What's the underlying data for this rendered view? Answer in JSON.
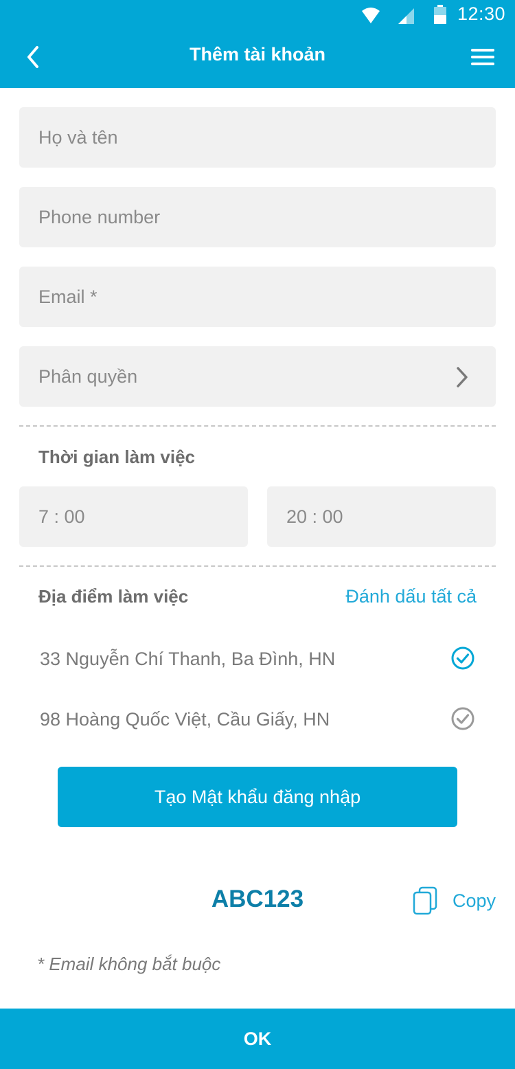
{
  "status_bar": {
    "time": "12:30"
  },
  "header": {
    "title": "Thêm tài khoản"
  },
  "form": {
    "full_name_placeholder": "Họ và tên",
    "phone_placeholder": "Phone number",
    "email_placeholder": "Email *",
    "role_placeholder": "Phân quyền"
  },
  "working_time": {
    "label": "Thời gian làm việc",
    "start": "7 : 00",
    "end": "20 : 00"
  },
  "working_location": {
    "label": "Địa điểm làm việc",
    "mark_all": "Đánh dấu tất cả",
    "items": [
      {
        "address": "33 Nguyễn Chí Thanh, Ba Đình, HN",
        "checked": true
      },
      {
        "address": "98 Hoàng Quốc Việt, Cầu Giấy, HN",
        "checked": false
      }
    ]
  },
  "password": {
    "create_button": "Tạo Mật khẩu đăng nhập",
    "value": "ABC123",
    "copy_label": "Copy"
  },
  "note": "* Email không bắt buộc",
  "footer": {
    "ok_label": "OK"
  },
  "colors": {
    "primary": "#02a7d6",
    "accent_text": "#21a9d8",
    "password_text": "#0d7fa8",
    "field_bg": "#f1f1f1",
    "unchecked": "#9a9a9a"
  }
}
